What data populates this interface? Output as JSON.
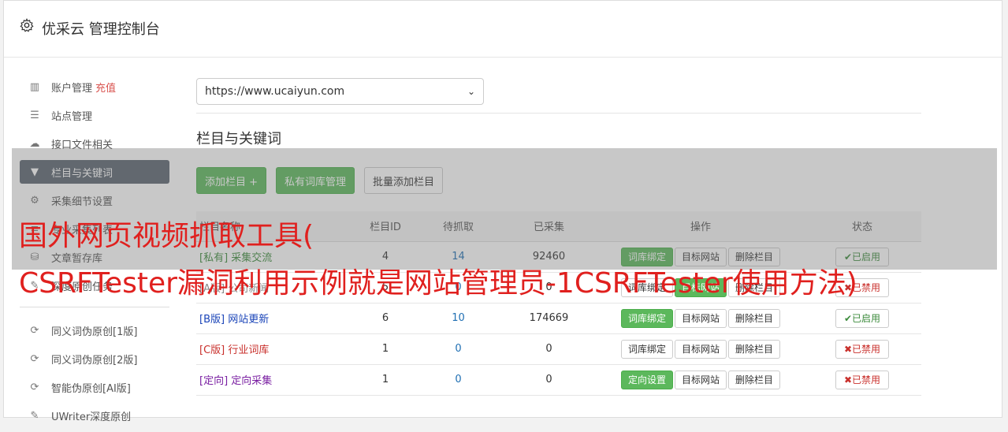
{
  "header": {
    "title": "优采云 管理控制台",
    "icon": "gear-icon"
  },
  "sidebar": {
    "items": [
      {
        "label": "账户管理",
        "extra": "充值",
        "icon": "bar-chart-icon"
      },
      {
        "label": "站点管理",
        "icon": "server-icon"
      },
      {
        "label": "接口文件相关",
        "icon": "cloud-upload-icon"
      },
      {
        "label": "栏目与关键词",
        "icon": "filter-icon",
        "active": true
      },
      {
        "label": "采集细节设置",
        "icon": "cogs-icon"
      },
      {
        "label": "专业采集列表",
        "icon": "list-icon"
      },
      {
        "label": "文章暂存库",
        "icon": "database-icon"
      },
      {
        "label": "深度原创任务",
        "icon": "edit-icon"
      }
    ],
    "items2": [
      {
        "label": "同义词伪原创[1版]",
        "icon": "refresh-icon"
      },
      {
        "label": "同义词伪原创[2版]",
        "icon": "refresh-icon"
      },
      {
        "label": "智能伪原创[AI版]",
        "icon": "refresh-icon"
      },
      {
        "label": "UWriter深度原创",
        "icon": "edit-icon"
      }
    ]
  },
  "main": {
    "site_select": {
      "value": "https://www.ucaiyun.com"
    },
    "section_title": "栏目与关键词",
    "buttons": {
      "add_column": "添加栏目 +",
      "private_lib": "私有词库管理",
      "batch_add": "批量添加栏目"
    },
    "table": {
      "headers": [
        "栏目名称",
        "栏目ID",
        "待抓取",
        "已采集",
        "操作",
        "状态"
      ],
      "rows": [
        {
          "tag": "[私有]",
          "name": "采集交流",
          "id": "4",
          "pending": "14",
          "collected": "92460",
          "op1": "词库绑定",
          "op2": "目标网站",
          "op3": "删除栏目",
          "status": "已启用",
          "on": true,
          "op1green": true,
          "op2green": false
        },
        {
          "tag": "[A版]",
          "name": "公司新闻",
          "id": "5",
          "pending": "0",
          "collected": "0",
          "op1": "词库绑定",
          "op2": "目标网站",
          "op3": "删除栏目",
          "status": "已禁用",
          "on": false,
          "op1green": false,
          "op2green": true
        },
        {
          "tag": "[B版]",
          "name": "网站更新",
          "id": "6",
          "pending": "10",
          "collected": "174669",
          "op1": "词库绑定",
          "op2": "目标网站",
          "op3": "删除栏目",
          "status": "已启用",
          "on": true,
          "op1green": true,
          "op2green": false
        },
        {
          "tag": "[C版]",
          "name": "行业词库",
          "id": "1",
          "pending": "0",
          "collected": "0",
          "op1": "词库绑定",
          "op2": "目标网站",
          "op3": "删除栏目",
          "status": "已禁用",
          "on": false,
          "op1green": false,
          "op2green": false
        },
        {
          "tag": "[定向]",
          "name": "定向采集",
          "id": "1",
          "pending": "0",
          "collected": "0",
          "op1": "定向设置",
          "op2": "目标网站",
          "op3": "删除栏目",
          "status": "已禁用",
          "on": false,
          "op1green": true,
          "op2green": false
        }
      ]
    }
  },
  "watermark": {
    "line1": "国外网页视频抓取工具(",
    "line2": "CSRFTester漏洞利用示例就是网站管理员-1CSRFTester使用方法)"
  }
}
